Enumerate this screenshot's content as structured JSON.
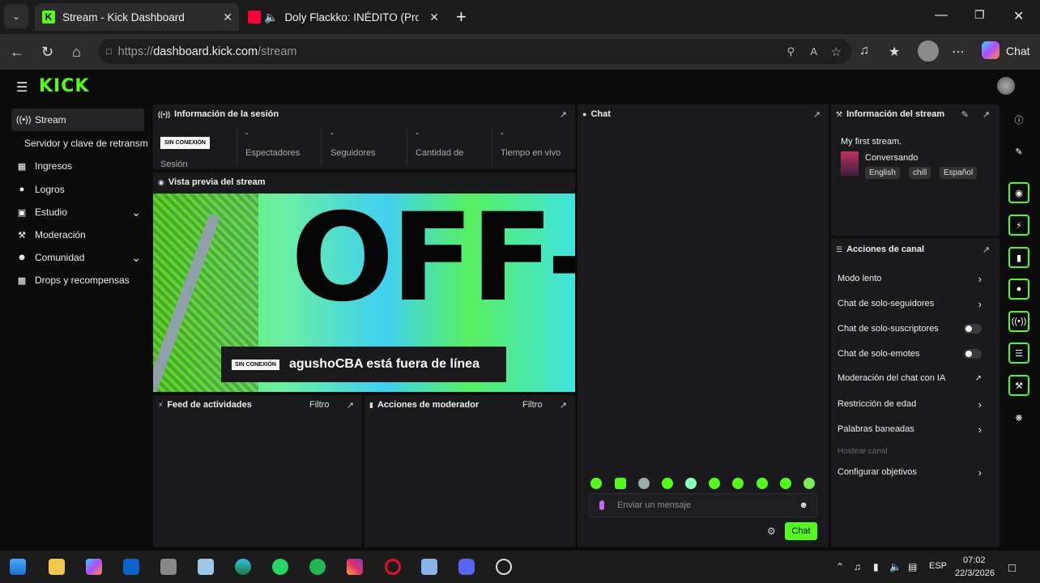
{
  "browser": {
    "tabs": [
      {
        "title": "Stream - Kick Dashboard"
      },
      {
        "title": "Doly Flackko: INÉDITO (Prod."
      }
    ],
    "url_scheme": "https://",
    "url_host": "dashboard.kick.com",
    "url_path": "/stream",
    "copilot_label": "Chat"
  },
  "kick": {
    "logo": "KICK",
    "sidebar": [
      {
        "label": "Stream",
        "icon": "broadcast-icon"
      },
      {
        "label": "Servidor y clave de retransm",
        "icon": ""
      },
      {
        "label": "Ingresos",
        "icon": "chart-icon"
      },
      {
        "label": "Logros",
        "icon": "trophy-icon"
      },
      {
        "label": "Estudio",
        "icon": "studio-icon"
      },
      {
        "label": "Moderación",
        "icon": "wrench-icon"
      },
      {
        "label": "Comunidad",
        "icon": "people-icon"
      },
      {
        "label": "Drops y recompensas",
        "icon": "gift-icon"
      }
    ],
    "session": {
      "title": "Información de la sesión",
      "badge": "SIN CONEXIÓN",
      "badge_label": "Sesión",
      "stats": [
        {
          "value": "-",
          "label": "Espectadores"
        },
        {
          "value": "-",
          "label": "Seguidores"
        },
        {
          "value": "-",
          "label": "Cantidad de"
        },
        {
          "value": "-",
          "label": "Tiempo en vivo"
        }
      ]
    },
    "preview": {
      "title": "Vista previa del stream",
      "offline_big": "OFF-LINE",
      "badge": "SIN CONEXIÓN",
      "message": "agushoCBA está fuera de línea"
    },
    "activity": {
      "title": "Feed de actividades",
      "filter": "Filtro"
    },
    "mod_actions": {
      "title": "Acciones de moderador",
      "filter": "Filtro"
    },
    "chat": {
      "title": "Chat",
      "input_placeholder": "Enviar un mensaje",
      "send_label": "Chat"
    },
    "stream_info": {
      "title": "Información del stream",
      "stream_title": "My first stream.",
      "category": "Conversando",
      "tags": [
        "English",
        "chill",
        "Español"
      ]
    },
    "channel_actions": {
      "title": "Acciones de canal",
      "items": [
        {
          "label": "Modo lento",
          "control": "chevron"
        },
        {
          "label": "Chat de solo-seguidores",
          "control": "chevron"
        },
        {
          "label": "Chat de solo-suscriptores",
          "control": "toggle"
        },
        {
          "label": "Chat de solo-emotes",
          "control": "toggle"
        },
        {
          "label": "Moderación del chat con IA",
          "control": "external"
        },
        {
          "label": "Restricción de edad",
          "control": "chevron"
        },
        {
          "label": "Palabras baneadas",
          "control": "chevron"
        },
        {
          "label": "Hostear canal",
          "control": "disabled"
        },
        {
          "label": "Configurar objetivos",
          "control": "chevron"
        }
      ]
    }
  },
  "taskbar": {
    "lang": "ESP",
    "time": "07:02",
    "date": "22/3/2026"
  },
  "colors": {
    "accent": "#53fc18",
    "panel": "#1a1a1c",
    "background": "#0b0b0c"
  }
}
